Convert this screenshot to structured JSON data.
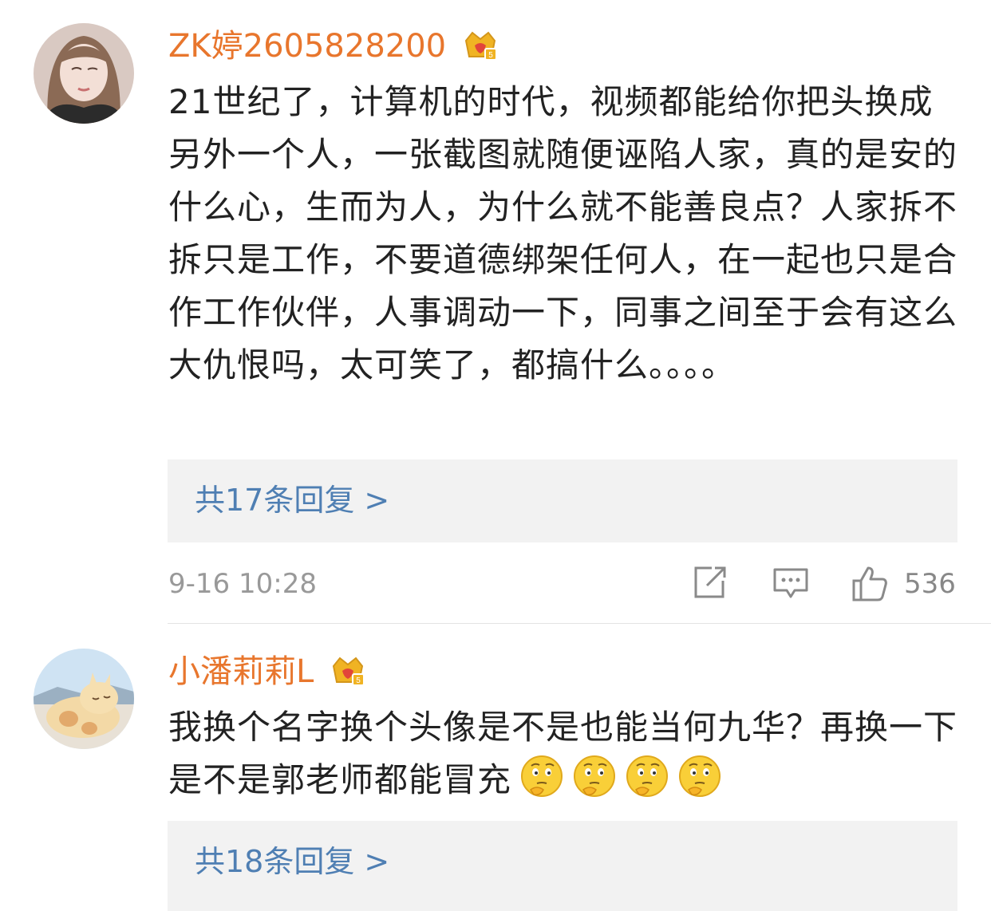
{
  "comments": [
    {
      "username": "ZK婷2605828200",
      "badge_icon": "crown-badge-icon",
      "text": "21世纪了，计算机的时代，视频都能给你把头换成另外一个人，一张截图就随便诬陷人家，真的是安的什么心，生而为人，为什么就不能善良点？人家拆不拆只是工作，不要道德绑架任何人，在一起也只是合作工作伙伴，人事调动一下，同事之间至于会有这么大仇恨吗，太可笑了，都搞什么。。。。",
      "replies_label": "共17条回复 >",
      "time": "9-16 10:28",
      "likes": "536"
    },
    {
      "username": "小潘莉莉L",
      "badge_icon": "crown-badge-icon",
      "text": "我换个名字换个头像是不是也能当何九华？再换一下是不是郭老师都能冒充",
      "emoji": [
        "thinking-emoji",
        "thinking-emoji",
        "thinking-emoji",
        "thinking-emoji"
      ],
      "replies_label": "共18条回复 >"
    }
  ],
  "colors": {
    "username": "#e8762d",
    "link": "#4f7fb3",
    "meta": "#999999",
    "reply_bg": "#f2f2f2"
  }
}
